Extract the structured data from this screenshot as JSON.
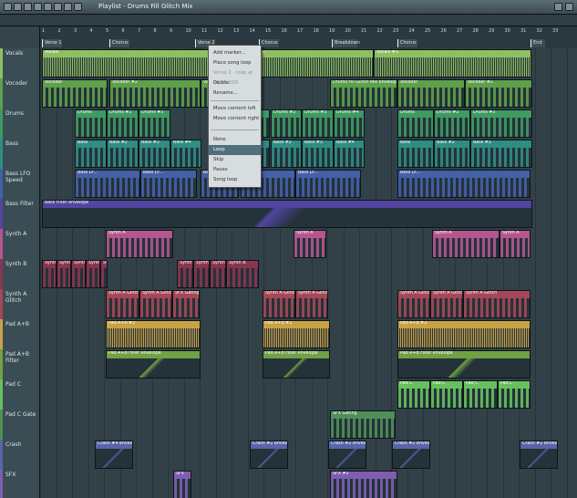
{
  "window": {
    "title": "Playlist - Drums Fill Glitch Mix"
  },
  "ruler": {
    "bars": [
      "1",
      "2",
      "3",
      "4",
      "5",
      "6",
      "7",
      "8",
      "9",
      "10",
      "11",
      "12",
      "13",
      "14",
      "15",
      "16",
      "17",
      "18",
      "19",
      "20",
      "21",
      "22",
      "23",
      "24",
      "25",
      "26",
      "27",
      "28",
      "29",
      "30",
      "31",
      "32",
      "33"
    ]
  },
  "markers": [
    "Verse 1",
    "Chorus",
    "Verse 2",
    "Chorus",
    "Breakdown",
    "Chorus",
    "End"
  ],
  "context_menu": {
    "items": [
      "Add marker...",
      "Place song loop",
      "Verse 2 - loop at 00:31:000",
      "Delete",
      "Rename...",
      "Move content left",
      "Move content right",
      "None",
      "Loop",
      "Skip",
      "Pause",
      "Song loop"
    ]
  },
  "tracks": [
    {
      "name": "Vocals",
      "color": "#8fbf63",
      "clips": [
        "Vocals",
        "Vocals #2",
        "Vocals #3"
      ]
    },
    {
      "name": "Vocoder",
      "color": "#5ea04b",
      "clips": [
        "Vocoder",
        "Vocoder #2",
        "Vocoder #3",
        "Drums Fill Glitch Mix envelope",
        "Vocoder",
        "Vocoder #2"
      ]
    },
    {
      "name": "Drums",
      "color": "#3f9a63",
      "clips": [
        "Drums",
        "Drums #2",
        "Drums #3",
        "Drums",
        "Drums #2",
        "Drums #3",
        "Drums #4",
        "Drums",
        "Drums #2",
        "Drums #3"
      ]
    },
    {
      "name": "Bass",
      "color": "#2f8d84",
      "clips": [
        "Bass",
        "Bass #2",
        "Bass #3",
        "Bass #4",
        "Bass",
        "Bass #2",
        "Bass #3",
        "Bass #4",
        "Bass",
        "Bass #2",
        "Bass #3"
      ]
    },
    {
      "name": "Bass LFO Speed",
      "color": "#4460a9",
      "clips": [
        "Bass LF...",
        "Bass LF...",
        "Bass LF...",
        "Bass LF...",
        "Bass LF...",
        "Bass LF..."
      ]
    },
    {
      "name": "Bass Filter",
      "color": "#5145a1",
      "clips": [
        "Bass Filter envelope"
      ]
    },
    {
      "name": "Synth A",
      "color": "#b55690",
      "clips": [
        "Synth A",
        "Synth A",
        "Synth A",
        "Synth A"
      ]
    },
    {
      "name": "Synth B",
      "color": "#8a3450",
      "clips": [
        "Synth B",
        "Synth B",
        "Synth B",
        "Synth B",
        "Synth B",
        "Synth B",
        "Synth B",
        "Synth B",
        "Synth B"
      ]
    },
    {
      "name": "Synth A Glitch",
      "color": "#a64757",
      "clips": [
        "Synth A Glitch",
        "Synth A Glitch",
        "SFX Gating",
        "Synth A Glitch",
        "Synth A Glitch",
        "Synth A Glitch",
        "Synth A Glitch",
        "Synth A Glitch"
      ]
    },
    {
      "name": "Pad A+B",
      "color": "#c9a247",
      "clips": [
        "Pad A+B #2",
        "Pad A+B #2",
        "Pad A+B #2"
      ]
    },
    {
      "name": "Pad A+B Filter",
      "color": "#70a144",
      "clips": [
        "Pad A+B Filter envelope",
        "Pad A+B Filter envelope",
        "Pad A+B Filter envelope"
      ]
    },
    {
      "name": "Pad C",
      "color": "#68bf5f",
      "clips": [
        "Pad C",
        "Pad C",
        "Pad C",
        "Pad C"
      ]
    },
    {
      "name": "Pad C Gate",
      "color": "#4f8f58",
      "clips": [
        "SFX Gating"
      ]
    },
    {
      "name": "Crash",
      "color": "#5965a8",
      "clips": [
        "Crash #4 envelope",
        "Crash #2 envelope",
        "Crash #2 envelope",
        "Crash #2 envelope",
        "Crash #2 envelope"
      ]
    },
    {
      "name": "SFX",
      "color": "#7f5db0",
      "clips": [
        "SFX",
        "SFX #2"
      ]
    }
  ]
}
